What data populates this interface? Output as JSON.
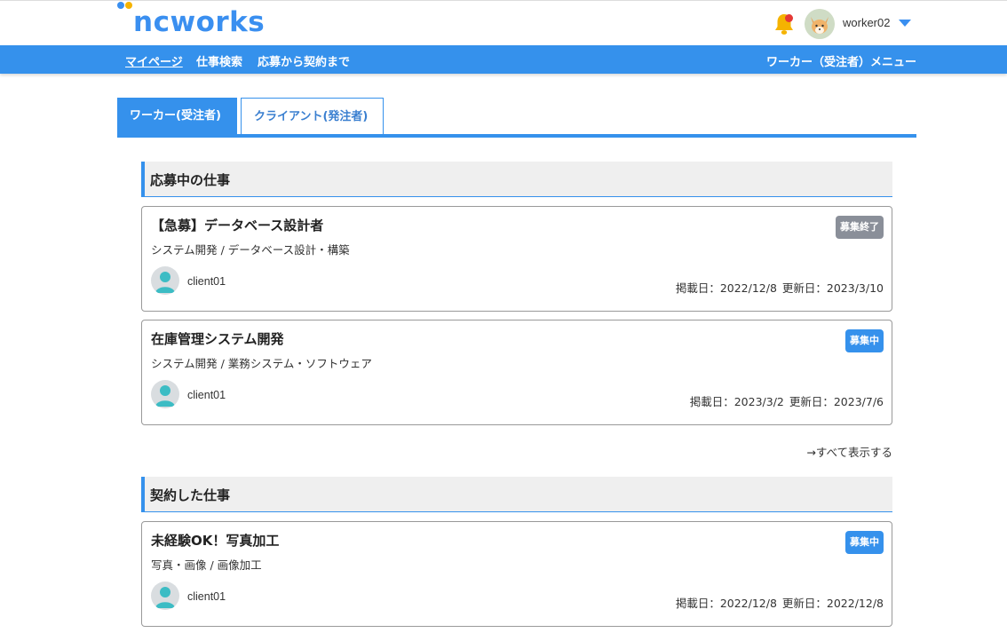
{
  "header": {
    "logo_text": "ncworks",
    "username": "worker02",
    "colors": {
      "brand": "#3591ec",
      "logo_dot_secondary": "#f5b301",
      "notify": "#e53935"
    }
  },
  "nav": {
    "items": [
      {
        "label": "マイページ",
        "active": true
      },
      {
        "label": "仕事検索"
      },
      {
        "label": "応募から契約まで"
      }
    ],
    "right_menu": "ワーカー（受注者）メニュー"
  },
  "tabs": [
    {
      "label": "ワーカー(受注者)",
      "active": true
    },
    {
      "label": "クライアント(発注者)",
      "active": false
    }
  ],
  "sections": {
    "applying": {
      "title": "応募中の仕事",
      "jobs": [
        {
          "title": "【急募】データベース設計者",
          "category": "システム開発 / データベース設計・構築",
          "status": "募集終了",
          "client": "client01",
          "posted": "掲載日：2022/12/8",
          "updated": "更新日：2023/3/10"
        },
        {
          "title": "在庫管理システム開発",
          "category": "システム開発 / 業務システム・ソフトウェア",
          "status": "募集中",
          "client": "client01",
          "posted": "掲載日：2023/3/2",
          "updated": "更新日：2023/7/6"
        }
      ],
      "show_all": "→すべて表示する"
    },
    "contracted": {
      "title": "契約した仕事",
      "jobs": [
        {
          "title": "未経験OK！写真加工",
          "category": "写真・画像 / 画像加工",
          "status": "募集中",
          "client": "client01",
          "posted": "掲載日：2022/12/8",
          "updated": "更新日：2022/12/8"
        }
      ]
    }
  }
}
